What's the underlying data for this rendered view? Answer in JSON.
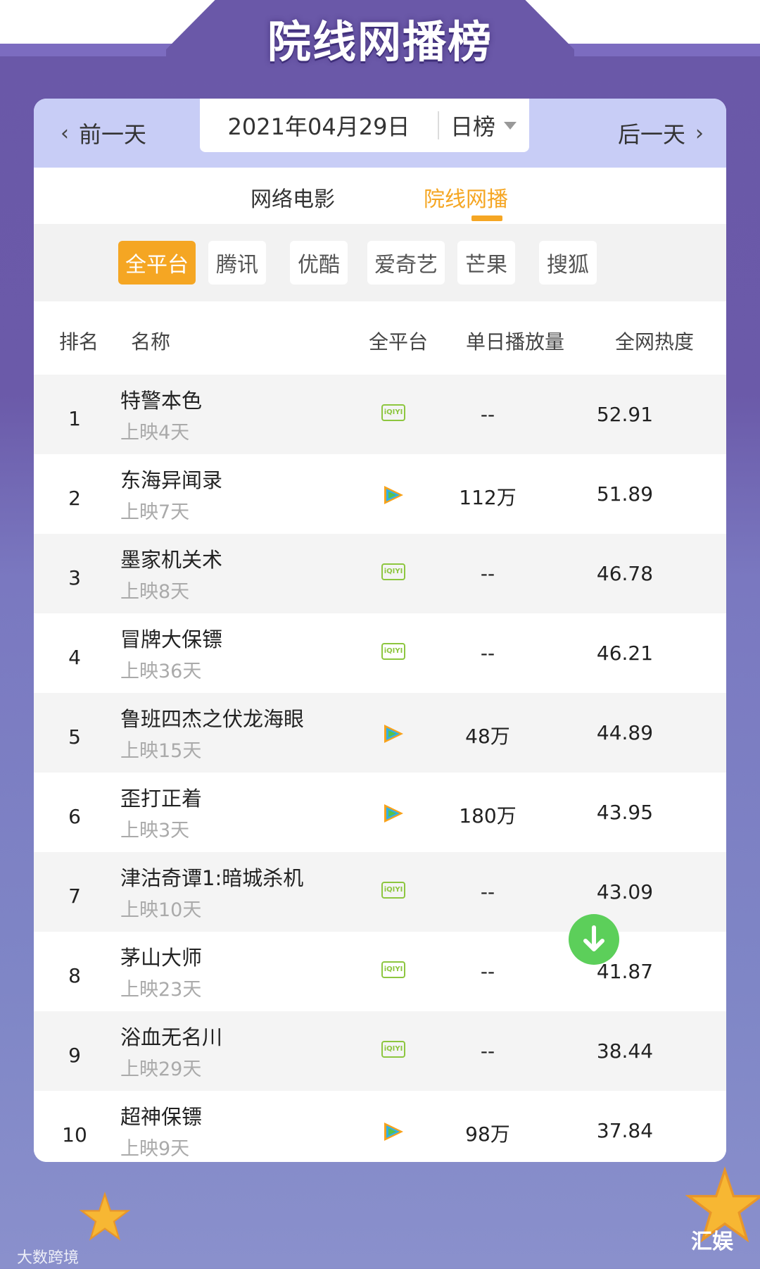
{
  "page_title": "院线网播榜",
  "date_bar": {
    "prev_label": "前一天",
    "next_label": "后一天",
    "date": "2021年04月29日",
    "rank_type": "日榜"
  },
  "category_tabs": [
    {
      "label": "网络电影",
      "active": false
    },
    {
      "label": "院线网播",
      "active": true
    }
  ],
  "platforms": [
    {
      "label": "全平台",
      "active": true
    },
    {
      "label": "腾讯",
      "active": false
    },
    {
      "label": "优酷",
      "active": false
    },
    {
      "label": "爱奇艺",
      "active": false
    },
    {
      "label": "芒果",
      "active": false
    },
    {
      "label": "搜狐",
      "active": false
    }
  ],
  "table": {
    "headers": {
      "rank": "排名",
      "name": "名称",
      "platform": "全平台",
      "daily_plays": "单日播放量",
      "heat": "全网热度"
    },
    "rows": [
      {
        "rank": "1",
        "title": "特警本色",
        "days": "上映4天",
        "platform": "iqiyi",
        "plays": "--",
        "heat": "52.91"
      },
      {
        "rank": "2",
        "title": "东海异闻录",
        "days": "上映7天",
        "platform": "tencent",
        "plays": "112万",
        "heat": "51.89"
      },
      {
        "rank": "3",
        "title": "墨家机关术",
        "days": "上映8天",
        "platform": "iqiyi",
        "plays": "--",
        "heat": "46.78"
      },
      {
        "rank": "4",
        "title": "冒牌大保镖",
        "days": "上映36天",
        "platform": "iqiyi",
        "plays": "--",
        "heat": "46.21"
      },
      {
        "rank": "5",
        "title": "鲁班四杰之伏龙海眼",
        "days": "上映15天",
        "platform": "tencent",
        "plays": "48万",
        "heat": "44.89"
      },
      {
        "rank": "6",
        "title": "歪打正着",
        "days": "上映3天",
        "platform": "tencent",
        "plays": "180万",
        "heat": "43.95"
      },
      {
        "rank": "7",
        "title": "津沽奇谭1:暗城杀机",
        "days": "上映10天",
        "platform": "iqiyi",
        "plays": "--",
        "heat": "43.09"
      },
      {
        "rank": "8",
        "title": "茅山大师",
        "days": "上映23天",
        "platform": "iqiyi",
        "plays": "--",
        "heat": "41.87"
      },
      {
        "rank": "9",
        "title": "浴血无名川",
        "days": "上映29天",
        "platform": "iqiyi",
        "plays": "--",
        "heat": "38.44"
      },
      {
        "rank": "10",
        "title": "超神保镖",
        "days": "上映9天",
        "platform": "tencent",
        "plays": "98万",
        "heat": "37.84"
      }
    ]
  },
  "platform_icons": {
    "iqiyi": "iQIYI",
    "tencent": "tencent-video-icon"
  },
  "footer": {
    "left_watermark": "大数跨境",
    "right_watermark": "汇娱"
  },
  "colors": {
    "accent": "#f5a623",
    "background": "#6b5aa9",
    "date_bar": "#c8cdf6",
    "iqiyi_green": "#8dc63f",
    "download_green": "#5ccf5a"
  }
}
